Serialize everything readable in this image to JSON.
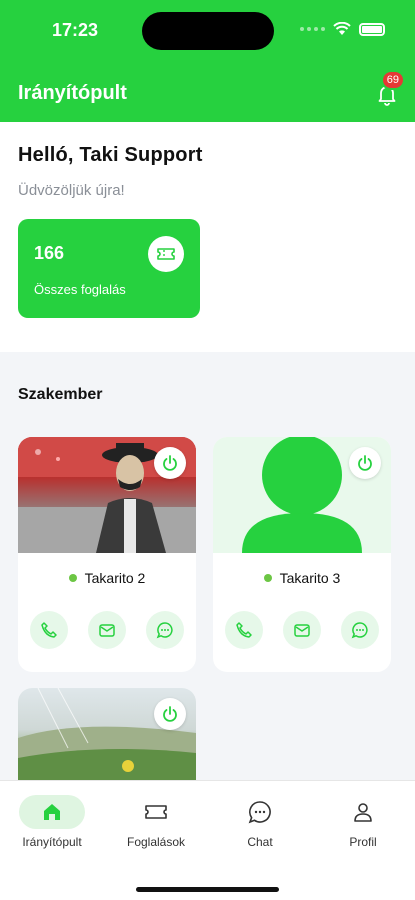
{
  "status": {
    "time": "17:23"
  },
  "header": {
    "title": "Irányítópult",
    "notif_count": "69"
  },
  "greeting": {
    "hello": "Helló, Taki Support",
    "welcome": "Üdvözöljük újra!"
  },
  "stats": {
    "bookings_count": "166",
    "bookings_label": "Összes foglalás"
  },
  "section": {
    "title": "Szakember"
  },
  "experts": [
    {
      "name": "Takarito 2",
      "online": true
    },
    {
      "name": "Takarito 3",
      "online": true
    },
    {
      "name": "",
      "online": true
    }
  ],
  "nav": [
    {
      "label": "Irányítópult",
      "icon": "home-icon",
      "active": true
    },
    {
      "label": "Foglalások",
      "icon": "ticket-icon",
      "active": false
    },
    {
      "label": "Chat",
      "icon": "chat-icon",
      "active": false
    },
    {
      "label": "Profil",
      "icon": "user-icon",
      "active": false
    }
  ],
  "colors": {
    "brand": "#26d13f",
    "badge": "#e53935",
    "action_bg": "#e6f8e9"
  }
}
